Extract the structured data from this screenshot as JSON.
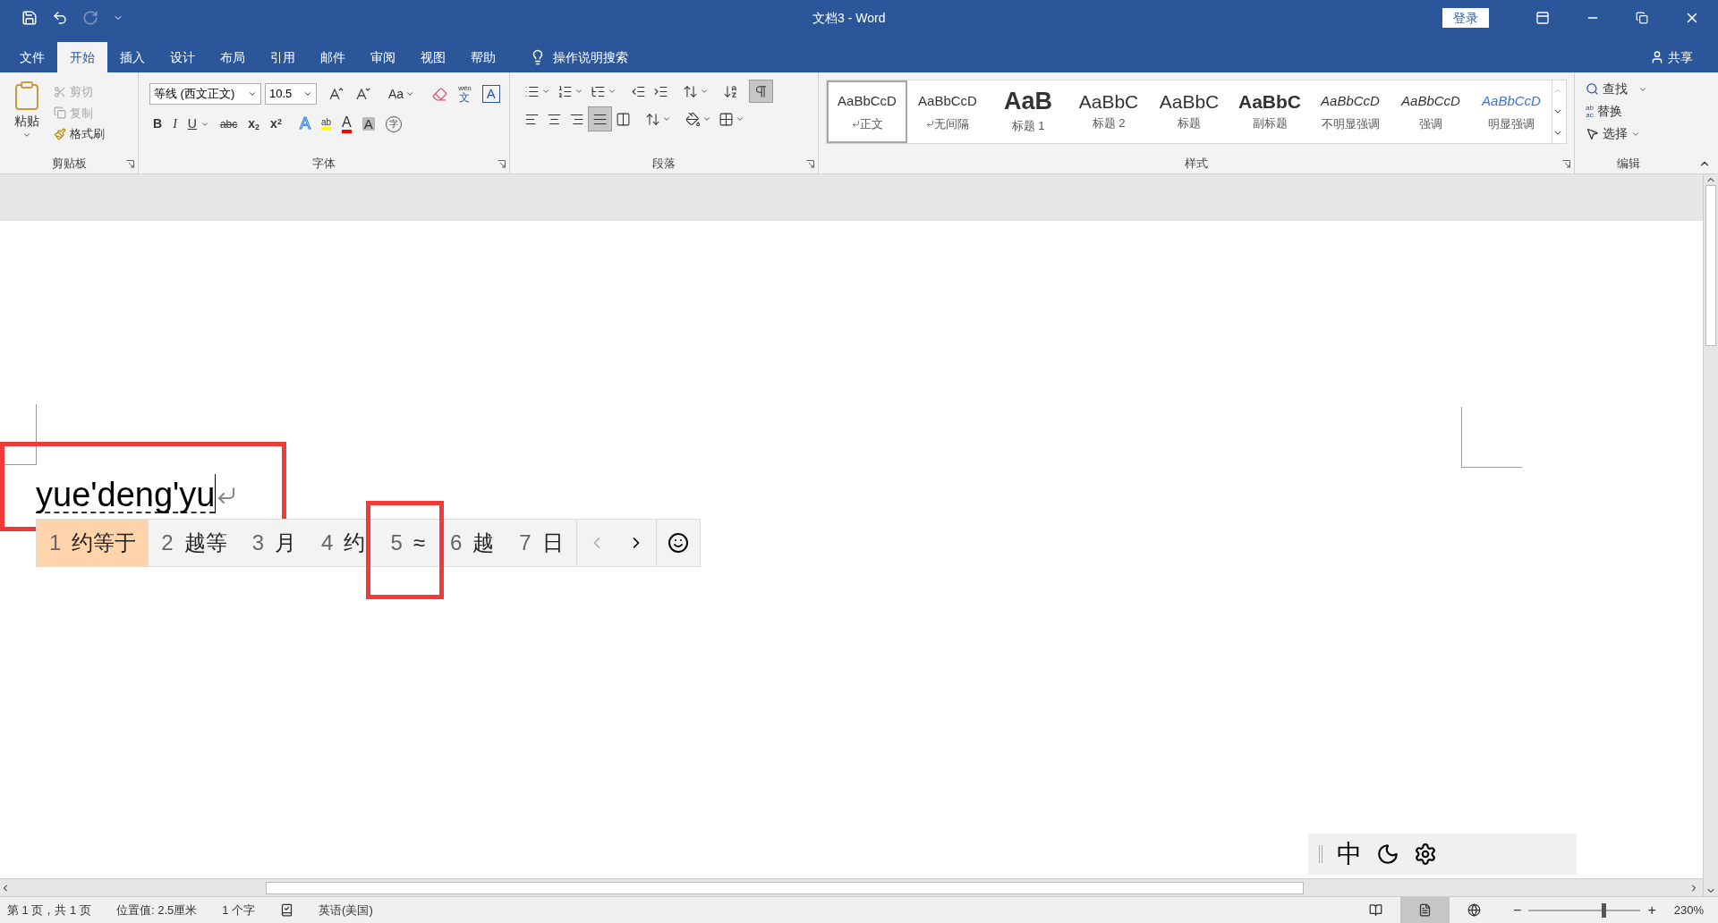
{
  "window": {
    "title": "文档3  -  Word",
    "sign_in": "登录",
    "share": "共享"
  },
  "tabs": [
    {
      "label": "文件",
      "selected": false
    },
    {
      "label": "开始",
      "selected": true
    },
    {
      "label": "插入",
      "selected": false
    },
    {
      "label": "设计",
      "selected": false
    },
    {
      "label": "布局",
      "selected": false
    },
    {
      "label": "引用",
      "selected": false
    },
    {
      "label": "邮件",
      "selected": false
    },
    {
      "label": "审阅",
      "selected": false
    },
    {
      "label": "视图",
      "selected": false
    },
    {
      "label": "帮助",
      "selected": false
    }
  ],
  "tell_me": "操作说明搜索",
  "clipboard": {
    "label": "剪贴板",
    "paste": "粘贴",
    "cut": {
      "label": "剪切",
      "disabled": true
    },
    "copy": {
      "label": "复制",
      "disabled": true
    },
    "format_painter": {
      "label": "格式刷",
      "disabled": false
    }
  },
  "font": {
    "label": "字体",
    "font_name": "等线 (西文正文)",
    "font_size": "10.5",
    "change_case": "Aa",
    "pinyin": "wén",
    "pinyin_char": "文",
    "border_char": "A",
    "bold": "B",
    "italic": "I",
    "underline": "U",
    "strikethrough": "abc",
    "subscript": "x",
    "subscript_mark": "2",
    "superscript": "x",
    "superscript_mark": "2",
    "effects": "A",
    "highlight": "ab",
    "font_color": "A",
    "shading": "A",
    "enclose": "字"
  },
  "paragraph": {
    "label": "段落",
    "justify_selected": true
  },
  "styles": {
    "label": "样式",
    "items": [
      {
        "preview": "AaBbCcD",
        "name": "正文",
        "kind": "plain",
        "selected": true,
        "para_mark": true
      },
      {
        "preview": "AaBbCcD",
        "name": "无间隔",
        "kind": "plain",
        "selected": false,
        "para_mark": true
      },
      {
        "preview": "AaB",
        "name": "标题 1",
        "kind": "large",
        "selected": false,
        "para_mark": false
      },
      {
        "preview": "AaBbC",
        "name": "标题 2",
        "kind": "medium",
        "selected": false,
        "para_mark": false
      },
      {
        "preview": "AaBbC",
        "name": "标题",
        "kind": "medium",
        "selected": false,
        "para_mark": false
      },
      {
        "preview": "AaBbC",
        "name": "副标题",
        "kind": "bold",
        "selected": false,
        "para_mark": false
      },
      {
        "preview": "AaBbCcD",
        "name": "不明显强调",
        "kind": "italic",
        "selected": false,
        "para_mark": false
      },
      {
        "preview": "AaBbCcD",
        "name": "强调",
        "kind": "italic",
        "selected": false,
        "para_mark": false
      },
      {
        "preview": "AaBbCcD",
        "name": "明显强调",
        "kind": "accent",
        "selected": false,
        "para_mark": false
      }
    ]
  },
  "editing": {
    "label": "编辑",
    "find": "查找",
    "replace": "替换",
    "replace_icon_top": "ab",
    "replace_icon_bottom": "ac",
    "select": "选择"
  },
  "document": {
    "text": "yue'deng'yu"
  },
  "candidates": [
    {
      "index": "1",
      "text": "约等于",
      "selected": true
    },
    {
      "index": "2",
      "text": "越等",
      "selected": false
    },
    {
      "index": "3",
      "text": "月",
      "selected": false
    },
    {
      "index": "4",
      "text": "约",
      "selected": false
    },
    {
      "index": "5",
      "text": "≈",
      "selected": false
    },
    {
      "index": "6",
      "text": "越",
      "selected": false
    },
    {
      "index": "7",
      "text": "日",
      "selected": false
    }
  ],
  "ime_toolbar": {
    "mode": "中"
  },
  "status_bar": {
    "page": "第 1 页，共 1 页",
    "position": "位置值: 2.5厘米",
    "words": "1 个字",
    "language": "英语(美国)",
    "zoom": "230%",
    "zoom_slider": {
      "level": 0.65
    },
    "zoom_minus": "−",
    "zoom_plus": "+",
    "views": [
      {
        "kind": "read",
        "selected": false
      },
      {
        "kind": "print",
        "selected": true
      },
      {
        "kind": "web",
        "selected": false
      }
    ]
  }
}
